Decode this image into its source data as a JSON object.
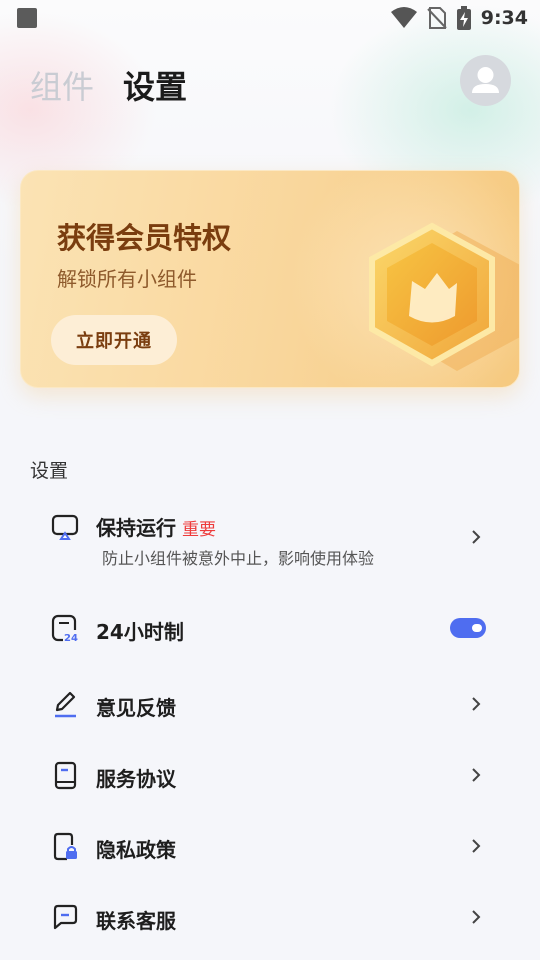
{
  "status_bar": {
    "time": "9:34"
  },
  "header": {
    "tab_widgets": "组件",
    "tab_settings": "设置"
  },
  "vip": {
    "title": "获得会员特权",
    "subtitle": "解锁所有小组件",
    "button": "立即开通"
  },
  "settings": {
    "section_title": "设置",
    "items": [
      {
        "label": "保持运行",
        "tag": "重要",
        "desc": "防止小组件被意外中止，影响使用体验",
        "icon": "keep-alive-icon",
        "control": "chevron"
      },
      {
        "label": "24小时制",
        "icon": "clock-24-icon",
        "control": "toggle",
        "enabled": true
      },
      {
        "label": "意见反馈",
        "icon": "pen-icon",
        "control": "chevron"
      },
      {
        "label": "服务协议",
        "icon": "document-icon",
        "control": "chevron"
      },
      {
        "label": "隐私政策",
        "icon": "lock-document-icon",
        "control": "chevron"
      },
      {
        "label": "联系客服",
        "icon": "chat-icon",
        "control": "chevron"
      }
    ]
  },
  "colors": {
    "accent": "#4f6df0",
    "important": "#ee3b3b",
    "vip_text": "#7a3d0f"
  }
}
